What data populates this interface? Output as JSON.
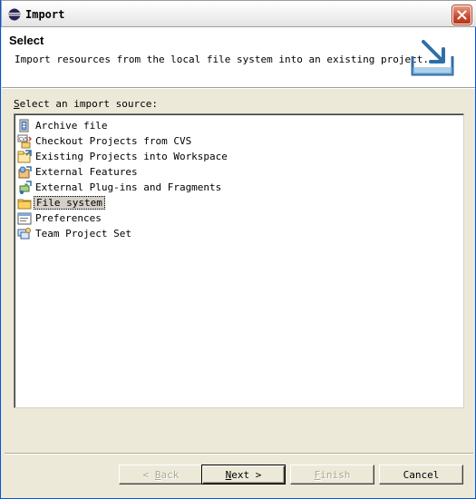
{
  "window": {
    "title": "Import",
    "close_glyph": "close-icon"
  },
  "header": {
    "title": "Select",
    "description": "Import resources from the local file system into an existing project.",
    "icon": "import-wizard-icon"
  },
  "source_list": {
    "label_mnemonic": "S",
    "label_rest": "elect an import source:",
    "items": [
      {
        "label": "Archive file",
        "icon": "archive-file-icon",
        "selected": false
      },
      {
        "label": "Checkout Projects from CVS",
        "icon": "cvs-icon",
        "selected": false
      },
      {
        "label": "Existing Projects into Workspace",
        "icon": "existing-projects-icon",
        "selected": false
      },
      {
        "label": "External Features",
        "icon": "external-features-icon",
        "selected": false
      },
      {
        "label": "External Plug-ins and Fragments",
        "icon": "external-plugins-icon",
        "selected": false
      },
      {
        "label": "File system",
        "icon": "folder-icon",
        "selected": true
      },
      {
        "label": "Preferences",
        "icon": "preferences-icon",
        "selected": false
      },
      {
        "label": "Team Project Set",
        "icon": "team-project-set-icon",
        "selected": false
      }
    ]
  },
  "buttons": {
    "back": {
      "prefix": "< ",
      "mnemonic": "B",
      "rest": "ack",
      "enabled": false
    },
    "next": {
      "mnemonic": "N",
      "rest": "ext >",
      "enabled": true
    },
    "finish": {
      "mnemonic": "F",
      "rest": "inish",
      "enabled": false
    },
    "cancel": {
      "label": "Cancel",
      "enabled": true
    }
  },
  "colors": {
    "dialog_bg": "#ece9d8",
    "selection_bg": "#d4d0c8",
    "close_button": "#c9492e"
  }
}
